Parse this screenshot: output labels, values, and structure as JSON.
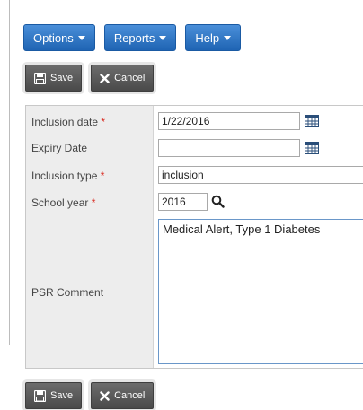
{
  "menu": {
    "options_label": "Options",
    "reports_label": "Reports",
    "help_label": "Help"
  },
  "toolbar": {
    "save_label": "Save",
    "cancel_label": "Cancel"
  },
  "form": {
    "inclusion_date": {
      "label": "Inclusion date",
      "required_mark": "*",
      "value": "1/22/2016"
    },
    "expiry_date": {
      "label": "Expiry Date",
      "value": ""
    },
    "inclusion_type": {
      "label": "Inclusion type",
      "required_mark": "*",
      "value": "inclusion"
    },
    "school_year": {
      "label": "School year",
      "required_mark": "*",
      "value": "2016"
    },
    "psr_comment": {
      "label": "PSR Comment",
      "value": "Medical Alert, Type 1 Diabetes"
    }
  },
  "colors": {
    "menu_button": "#2d74c4",
    "action_button": "#555555",
    "required": "#d9261c",
    "label_column": "#ededed"
  },
  "icons": {
    "calendar": "calendar-icon",
    "search": "search-icon",
    "save": "floppy-disk-icon",
    "cancel": "close-icon"
  }
}
